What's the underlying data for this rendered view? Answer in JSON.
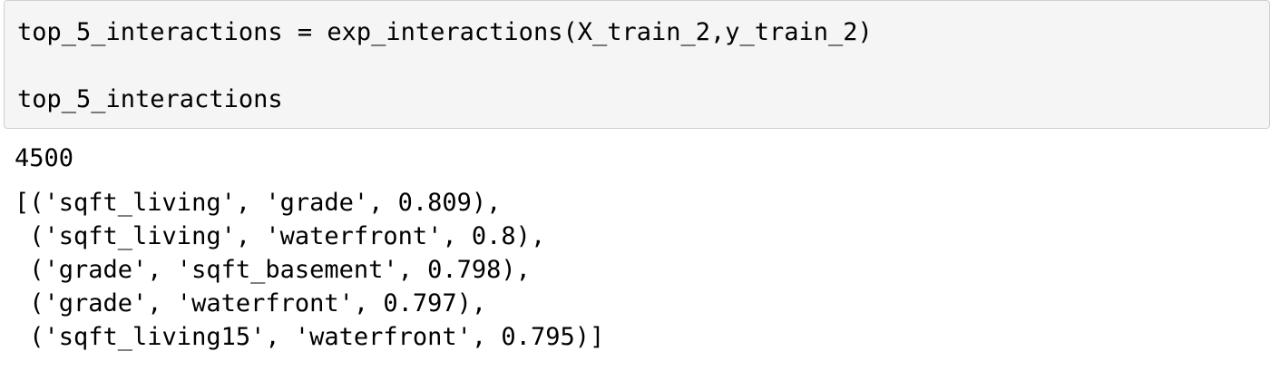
{
  "input": {
    "lines": [
      "top_5_interactions = exp_interactions(X_train_2,y_train_2)",
      "",
      "top_5_interactions"
    ]
  },
  "output": {
    "stdout": "4500",
    "result_lines": [
      "[('sqft_living', 'grade', 0.809),",
      " ('sqft_living', 'waterfront', 0.8),",
      " ('grade', 'sqft_basement', 0.798),",
      " ('grade', 'waterfront', 0.797),",
      " ('sqft_living15', 'waterfront', 0.795)]"
    ]
  },
  "colors": {
    "input_background": "#f5f5f5",
    "input_border": "#cfcfcf",
    "text": "#000000"
  }
}
